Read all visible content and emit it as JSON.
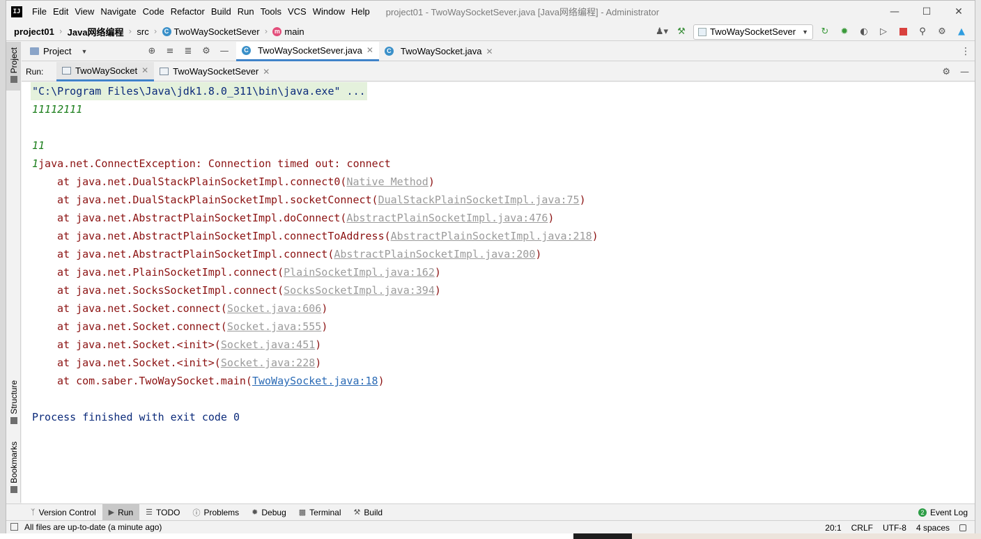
{
  "app": {
    "logo": "IJ",
    "window_title": "project01 - TwoWaySocketSever.java [Java网络编程] - Administrator"
  },
  "menu": [
    "File",
    "Edit",
    "View",
    "Navigate",
    "Code",
    "Refactor",
    "Build",
    "Run",
    "Tools",
    "VCS",
    "Window",
    "Help"
  ],
  "breadcrumb": {
    "project": "project01",
    "module": "Java网络编程",
    "folder": "src",
    "class": "TwoWaySocketSever",
    "method": "main"
  },
  "toolbar": {
    "run_config": "TwoWaySocketSever"
  },
  "left_stripe": {
    "project": "Project",
    "structure": "Structure",
    "bookmarks": "Bookmarks"
  },
  "project_panel": {
    "label": "Project"
  },
  "editor_tabs": [
    {
      "label": "TwoWaySocketSever.java",
      "active": true
    },
    {
      "label": "TwoWaySocket.java",
      "active": false
    }
  ],
  "run_panel": {
    "label": "Run:",
    "tabs": [
      {
        "label": "TwoWaySocket",
        "active": true
      },
      {
        "label": "TwoWaySocketSever",
        "active": false
      }
    ]
  },
  "console": {
    "command": "\"C:\\Program Files\\Java\\jdk1.8.0_311\\bin\\java.exe\" ...",
    "output1": "11112111",
    "output2": "11",
    "output3_prefix": "1",
    "exception": "java.net.ConnectException: Connection timed out: connect",
    "stack": [
      {
        "method": "at java.net.DualStackPlainSocketImpl.connect0(",
        "link": "Native Method",
        "suffix": ")"
      },
      {
        "method": "at java.net.DualStackPlainSocketImpl.socketConnect(",
        "link": "DualStackPlainSocketImpl.java:75",
        "suffix": ")"
      },
      {
        "method": "at java.net.AbstractPlainSocketImpl.doConnect(",
        "link": "AbstractPlainSocketImpl.java:476",
        "suffix": ")"
      },
      {
        "method": "at java.net.AbstractPlainSocketImpl.connectToAddress(",
        "link": "AbstractPlainSocketImpl.java:218",
        "suffix": ")"
      },
      {
        "method": "at java.net.AbstractPlainSocketImpl.connect(",
        "link": "AbstractPlainSocketImpl.java:200",
        "suffix": ")"
      },
      {
        "method": "at java.net.PlainSocketImpl.connect(",
        "link": "PlainSocketImpl.java:162",
        "suffix": ")"
      },
      {
        "method": "at java.net.SocksSocketImpl.connect(",
        "link": "SocksSocketImpl.java:394",
        "suffix": ")"
      },
      {
        "method": "at java.net.Socket.connect(",
        "link": "Socket.java:606",
        "suffix": ")"
      },
      {
        "method": "at java.net.Socket.connect(",
        "link": "Socket.java:555",
        "suffix": ")"
      },
      {
        "method": "at java.net.Socket.<init>(",
        "link": "Socket.java:451",
        "suffix": ")"
      },
      {
        "method": "at java.net.Socket.<init>(",
        "link": "Socket.java:228",
        "suffix": ")"
      },
      {
        "method": "at com.saber.TwoWaySocket.main(",
        "link": "TwoWaySocket.java:18",
        "suffix": ")"
      }
    ],
    "finished": "Process finished with exit code 0"
  },
  "bottom_tabs": [
    {
      "label": "Version Control",
      "icon": "branch-icon",
      "active": false
    },
    {
      "label": "Run",
      "icon": "play-icon",
      "active": true
    },
    {
      "label": "TODO",
      "icon": "list-icon",
      "active": false
    },
    {
      "label": "Problems",
      "icon": "info-icon",
      "active": false
    },
    {
      "label": "Debug",
      "icon": "bug-icon",
      "active": false
    },
    {
      "label": "Terminal",
      "icon": "terminal-icon",
      "active": false
    },
    {
      "label": "Build",
      "icon": "hammer-icon",
      "active": false
    }
  ],
  "event_log": {
    "count": "2",
    "label": "Event Log"
  },
  "status_bar": {
    "message": "All files are up-to-date (a minute ago)",
    "position": "20:1",
    "line_sep": "CRLF",
    "encoding": "UTF-8",
    "indent": "4 spaces"
  },
  "colors": {
    "accent": "#4083c9",
    "error_text": "#8b1111",
    "success_text": "#1d7f1d",
    "command_bg": "#e4f1dc",
    "link_blue": "#2a6ab5"
  }
}
